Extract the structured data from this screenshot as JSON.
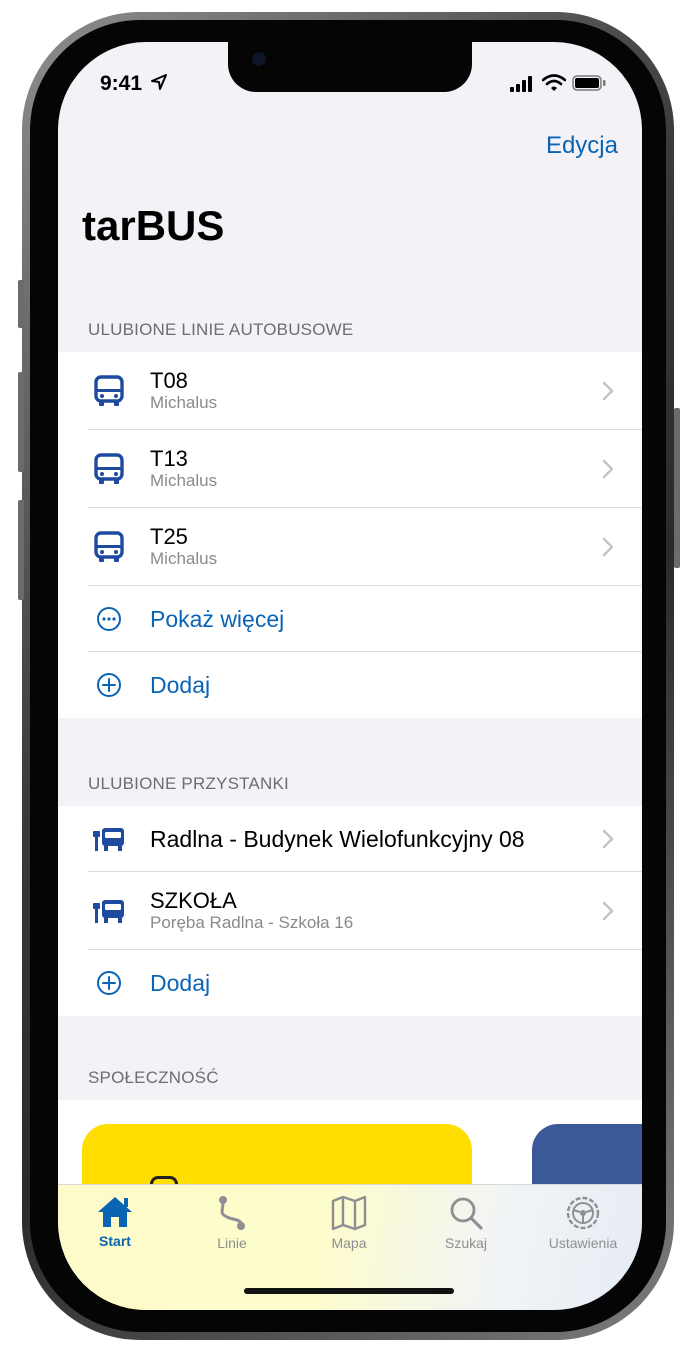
{
  "status_bar": {
    "time": "9:41"
  },
  "header": {
    "edit_label": "Edycja",
    "title": "tarBUS"
  },
  "favorite_lines": {
    "header": "ULUBIONE LINIE AUTOBUSOWE",
    "items": [
      {
        "name": "T08",
        "operator": "Michalus",
        "icon": "bus-icon"
      },
      {
        "name": "T13",
        "operator": "Michalus",
        "icon": "bus-icon"
      },
      {
        "name": "T25",
        "operator": "Michalus",
        "icon": "bus-icon"
      }
    ],
    "show_more_label": "Pokaż więcej",
    "add_label": "Dodaj"
  },
  "favorite_stops": {
    "header": "ULUBIONE PRZYSTANKI",
    "items": [
      {
        "name": "Radlna - Budynek Wielofunkcyjny 08",
        "subtitle": "",
        "icon": "bus-stop-icon"
      },
      {
        "name": "SZKOŁA",
        "subtitle": "Poręba Radlna - Szkoła 16",
        "icon": "bus-stop-icon"
      }
    ],
    "add_label": "Dodaj"
  },
  "community": {
    "header": "SPOŁECZNOŚĆ"
  },
  "tabbar": {
    "tabs": [
      {
        "label": "Start",
        "icon": "house-icon",
        "active": true
      },
      {
        "label": "Linie",
        "icon": "route-icon",
        "active": false
      },
      {
        "label": "Mapa",
        "icon": "map-icon",
        "active": false
      },
      {
        "label": "Szukaj",
        "icon": "search-icon",
        "active": false
      },
      {
        "label": "Ustawienia",
        "icon": "steering-wheel-icon",
        "active": false
      }
    ]
  },
  "colors": {
    "accent": "#0a64b4",
    "bus_icon": "#1e4aa0",
    "background": "#f2f2f7",
    "card_yellow": "#ffde00",
    "card_blue": "#3b5998"
  }
}
